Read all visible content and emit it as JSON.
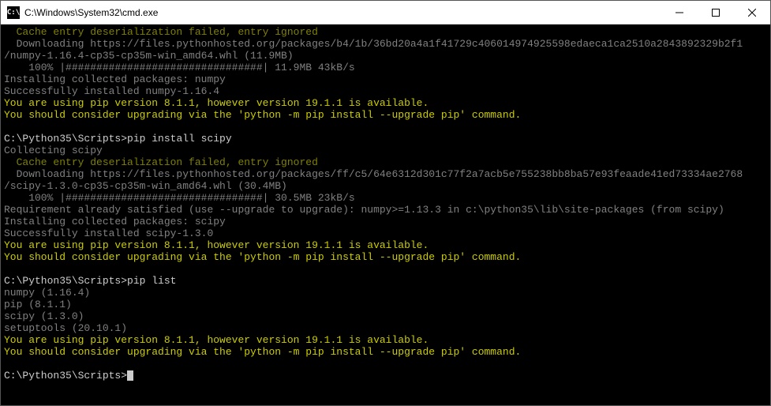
{
  "titlebar": {
    "icon_text": "C:\\",
    "title": "C:\\Windows\\System32\\cmd.exe"
  },
  "lines": [
    {
      "color": "c-olive",
      "indent": "  ",
      "text": "Cache entry deserialization failed, entry ignored"
    },
    {
      "color": "c-gray",
      "indent": "  ",
      "text": "Downloading https://files.pythonhosted.org/packages/b4/1b/36bd20a4a1f41729c406014974925598edaeca1ca2510a2843892329b2f1"
    },
    {
      "color": "c-gray",
      "indent": "",
      "text": "/numpy-1.16.4-cp35-cp35m-win_amd64.whl (11.9MB)"
    },
    {
      "color": "c-gray",
      "indent": "    ",
      "text": "100% |################################| 11.9MB 43kB/s"
    },
    {
      "color": "c-gray",
      "indent": "",
      "text": "Installing collected packages: numpy"
    },
    {
      "color": "c-gray",
      "indent": "",
      "text": "Successfully installed numpy-1.16.4"
    },
    {
      "color": "c-yellow",
      "indent": "",
      "text": "You are using pip version 8.1.1, however version 19.1.1 is available."
    },
    {
      "color": "c-yellow",
      "indent": "",
      "text": "You should consider upgrading via the 'python -m pip install --upgrade pip' command."
    },
    {
      "color": "c-white",
      "indent": "",
      "text": ""
    },
    {
      "prompt": "C:\\Python35\\Scripts>",
      "command": "pip install scipy"
    },
    {
      "color": "c-gray",
      "indent": "",
      "text": "Collecting scipy"
    },
    {
      "color": "c-olive",
      "indent": "  ",
      "text": "Cache entry deserialization failed, entry ignored"
    },
    {
      "color": "c-gray",
      "indent": "  ",
      "text": "Downloading https://files.pythonhosted.org/packages/ff/c5/64e6312d301c77f2a7acb5e755238bb8ba57e93feaade41ed73334ae2768"
    },
    {
      "color": "c-gray",
      "indent": "",
      "text": "/scipy-1.3.0-cp35-cp35m-win_amd64.whl (30.4MB)"
    },
    {
      "color": "c-gray",
      "indent": "    ",
      "text": "100% |################################| 30.5MB 23kB/s"
    },
    {
      "color": "c-gray",
      "indent": "",
      "text": "Requirement already satisfied (use --upgrade to upgrade): numpy>=1.13.3 in c:\\python35\\lib\\site-packages (from scipy)"
    },
    {
      "color": "c-gray",
      "indent": "",
      "text": "Installing collected packages: scipy"
    },
    {
      "color": "c-gray",
      "indent": "",
      "text": "Successfully installed scipy-1.3.0"
    },
    {
      "color": "c-yellow",
      "indent": "",
      "text": "You are using pip version 8.1.1, however version 19.1.1 is available."
    },
    {
      "color": "c-yellow",
      "indent": "",
      "text": "You should consider upgrading via the 'python -m pip install --upgrade pip' command."
    },
    {
      "color": "c-white",
      "indent": "",
      "text": ""
    },
    {
      "prompt": "C:\\Python35\\Scripts>",
      "command": "pip list"
    },
    {
      "color": "c-gray",
      "indent": "",
      "text": "numpy (1.16.4)"
    },
    {
      "color": "c-gray",
      "indent": "",
      "text": "pip (8.1.1)"
    },
    {
      "color": "c-gray",
      "indent": "",
      "text": "scipy (1.3.0)"
    },
    {
      "color": "c-gray",
      "indent": "",
      "text": "setuptools (20.10.1)"
    },
    {
      "color": "c-yellow",
      "indent": "",
      "text": "You are using pip version 8.1.1, however version 19.1.1 is available."
    },
    {
      "color": "c-yellow",
      "indent": "",
      "text": "You should consider upgrading via the 'python -m pip install --upgrade pip' command."
    },
    {
      "color": "c-white",
      "indent": "",
      "text": ""
    },
    {
      "prompt": "C:\\Python35\\Scripts>",
      "command": "",
      "cursor": true
    }
  ]
}
